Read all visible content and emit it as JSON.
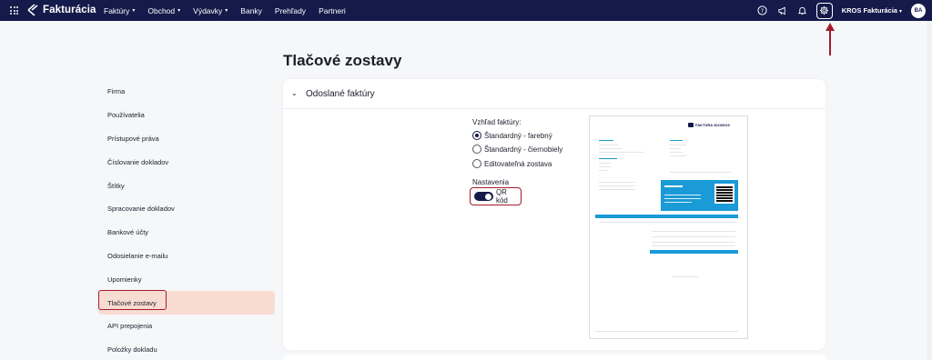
{
  "topbar": {
    "app_name": "Fakturácia",
    "nav": [
      {
        "label": "Faktúry",
        "has_menu": true
      },
      {
        "label": "Obchod",
        "has_menu": true
      },
      {
        "label": "Výdavky",
        "has_menu": true
      },
      {
        "label": "Banky",
        "has_menu": false
      },
      {
        "label": "Prehľady",
        "has_menu": false
      },
      {
        "label": "Partneri",
        "has_menu": false
      }
    ],
    "icons": [
      "help-icon",
      "megaphone-icon",
      "bell-icon",
      "gear-icon"
    ],
    "company": "KROS Fakturácia",
    "avatar_initials": "BA",
    "colors": {
      "nav_bg": "#141a4a",
      "highlight": "#a31b2d"
    }
  },
  "page": {
    "title": "Tlačové zostavy"
  },
  "sidebar": {
    "items": [
      {
        "label": "Firma",
        "active": false
      },
      {
        "label": "Používatelia",
        "active": false
      },
      {
        "label": "Prístupové práva",
        "active": false
      },
      {
        "label": "Číslovanie dokladov",
        "active": false
      },
      {
        "label": "Štítky",
        "active": false
      },
      {
        "label": "Spracovanie dokladov",
        "active": false
      },
      {
        "label": "Bankové účty",
        "active": false
      },
      {
        "label": "Odosielanie e-mailu",
        "active": false
      },
      {
        "label": "Upomienky",
        "active": false
      },
      {
        "label": "Tlačové zostavy",
        "active": true
      },
      {
        "label": "API prepojenia",
        "active": false
      },
      {
        "label": "Položky dokladu",
        "active": false
      }
    ],
    "active_bg": "#f8dcd2"
  },
  "card": {
    "title": "Odoslané faktúry",
    "appearance_label": "Vzhľad faktúry:",
    "options": [
      {
        "label": "Štandardný - farebný",
        "selected": true
      },
      {
        "label": "Štandardný - čiernobiely",
        "selected": false
      },
      {
        "label": "Editovateľná zostava",
        "selected": false
      }
    ],
    "settings_label": "Nastavenia",
    "qr_toggle": {
      "label": "QR kód",
      "on": true
    }
  },
  "preview": {
    "title": "FAKTÚRA 20230016"
  }
}
